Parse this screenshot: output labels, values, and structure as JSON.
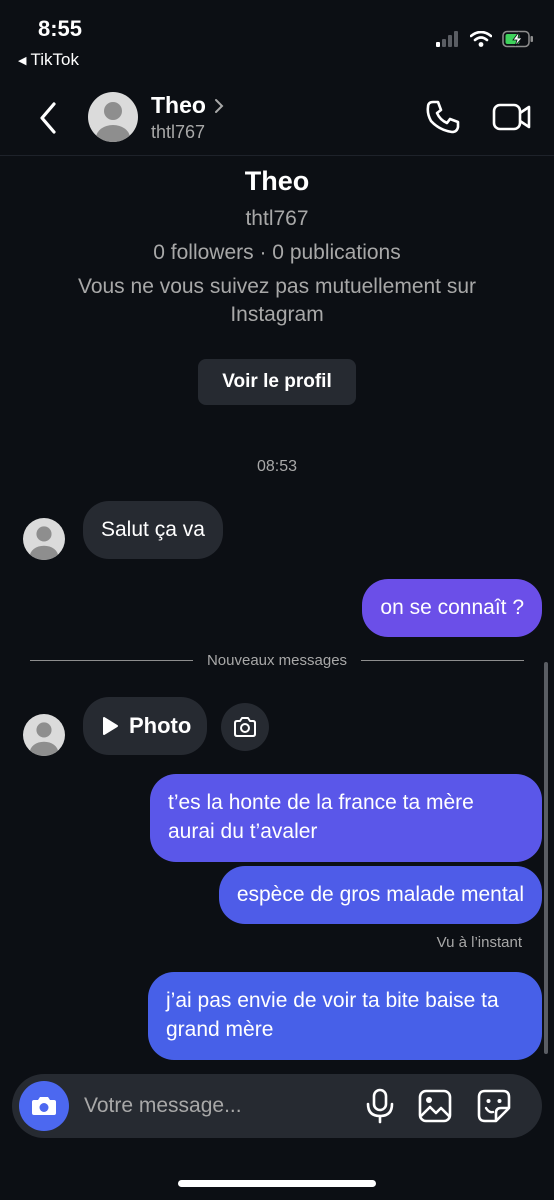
{
  "status_bar": {
    "time": "8:55",
    "back_app": "TikTok"
  },
  "header": {
    "name": "Theo",
    "username": "thtl767"
  },
  "profile": {
    "name": "Theo",
    "username": "thtl767",
    "stats": "0 followers · 0 publications",
    "mutual": "Vous ne vous suivez pas mutuellement sur Instagram",
    "button": "Voir le profil"
  },
  "thread": {
    "timestamp": "08:53",
    "msg1": "Salut ça va",
    "msg2": "on se connaît ?",
    "new_messages": "Nouveaux messages",
    "photo_label": "Photo",
    "msg3": "t’es la honte de la france ta mère aurai du t’avaler",
    "msg4": "espèce de gros malade mental",
    "seen": "Vu à l’instant",
    "msg5": "j’ai pas envie de voir ta bite baise ta grand mère"
  },
  "composer": {
    "placeholder": "Votre message..."
  },
  "colors": {
    "background": "#0c0f14",
    "bubble_incoming": "#262a31",
    "bubble_out_purple": "#6b4fe8",
    "bubble_out_blue": "#4b5ee8",
    "camera_button": "#4c68f0"
  },
  "icons": [
    "back-chevron",
    "phone",
    "video-camera",
    "camera",
    "play",
    "microphone",
    "gallery",
    "sticker",
    "wifi",
    "cellular",
    "battery"
  ]
}
